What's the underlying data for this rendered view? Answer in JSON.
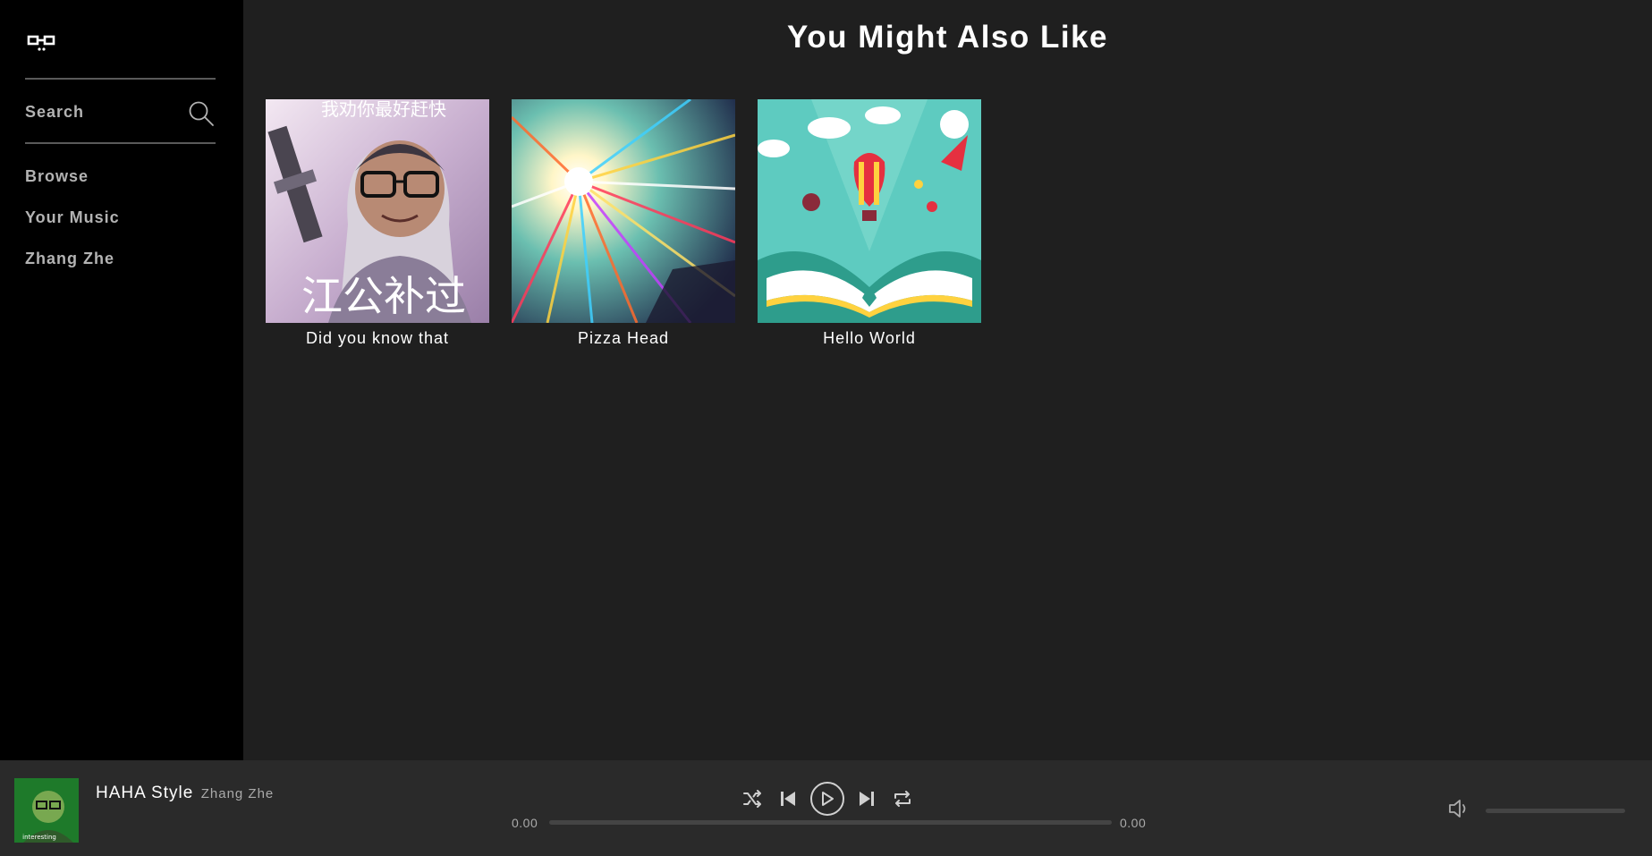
{
  "sidebar": {
    "logo_icon": "glasses-logo-icon",
    "search": {
      "label": "Search",
      "icon": "search-icon"
    },
    "nav": [
      {
        "label": "Browse"
      },
      {
        "label": "Your Music"
      },
      {
        "label": "Zhang Zhe"
      }
    ]
  },
  "main": {
    "title": "You Might Also Like",
    "cards": [
      {
        "title": "Did you know that",
        "cover_top_text": "我劝你最好赶快",
        "cover_bottom_text": "江公补过"
      },
      {
        "title": "Pizza Head"
      },
      {
        "title": "Hello World"
      }
    ]
  },
  "player": {
    "now_playing": {
      "title": "HAHA Style",
      "artist": "Zhang Zhe",
      "cover_text": "interesting"
    },
    "current_time": "0.00",
    "total_time": "0.00",
    "progress": 0,
    "volume": 0
  }
}
